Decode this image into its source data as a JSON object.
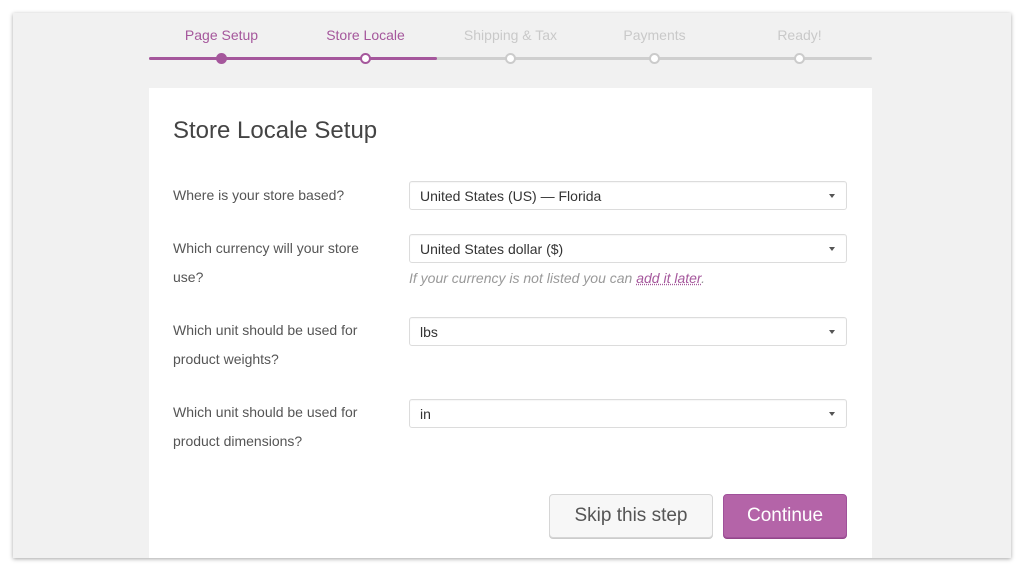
{
  "steps": [
    {
      "label": "Page Setup",
      "state": "done"
    },
    {
      "label": "Store Locale",
      "state": "active"
    },
    {
      "label": "Shipping & Tax",
      "state": "pending"
    },
    {
      "label": "Payments",
      "state": "pending"
    },
    {
      "label": "Ready!",
      "state": "pending"
    }
  ],
  "colors": {
    "accent": "#a5579c",
    "button_primary": "#b464a8",
    "inactive": "#cbcbcb",
    "panel_bg": "#f1f1f1"
  },
  "card": {
    "title": "Store Locale Setup",
    "fields": [
      {
        "label": "Where is your store based?",
        "value": "United States (US) — Florida"
      },
      {
        "label": "Which currency will your store use?",
        "value": "United States dollar ($)"
      },
      {
        "label": "Which unit should be used for product weights?",
        "value": "lbs"
      },
      {
        "label": "Which unit should be used for product dimensions?",
        "value": "in"
      }
    ],
    "currency_help_prefix": "If your currency is not listed you can ",
    "currency_help_link": "add it later",
    "currency_help_suffix": "."
  },
  "buttons": {
    "skip": "Skip this step",
    "continue": "Continue"
  }
}
